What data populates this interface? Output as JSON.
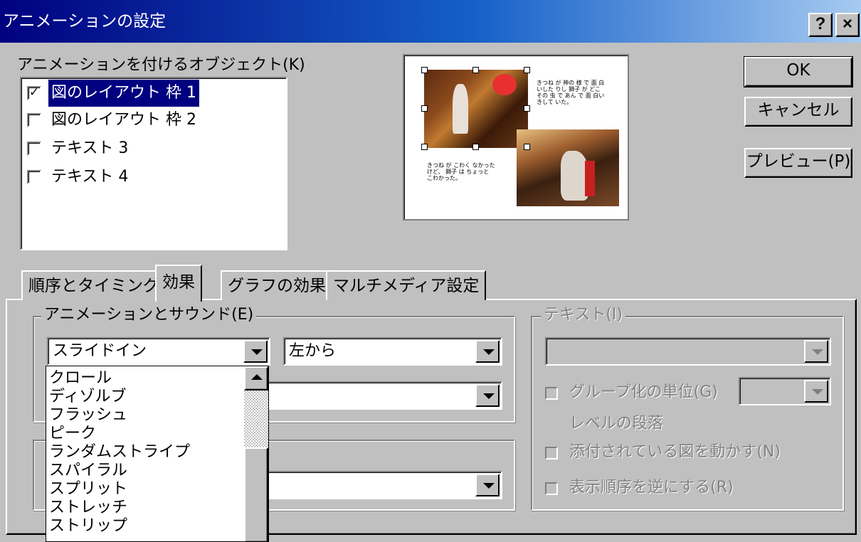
{
  "window": {
    "title": "アニメーションの設定",
    "help_button": "?",
    "close_button": "×"
  },
  "objects": {
    "label": "アニメーションを付けるオブジェクト(K)",
    "items": [
      {
        "label": "図のレイアウト 枠 1",
        "checked": true,
        "selected": true
      },
      {
        "label": "図のレイアウト 枠 2",
        "checked": false,
        "selected": false
      },
      {
        "label": "テキスト 3",
        "checked": false,
        "selected": false
      },
      {
        "label": "テキスト 4",
        "checked": false,
        "selected": false
      }
    ]
  },
  "preview": {
    "text_top": "きつね が 神の 様 で 面 白\nいした りし 獅子 が どこ\nその 虫 で あん で 面 白い\nきして いた。",
    "text_bottom": "きつね が こわく なかった\nけど、 獅子 は ちょっと\nこわかった。"
  },
  "buttons": {
    "ok": "OK",
    "cancel": "キャンセル",
    "preview": "プレビュー(P)"
  },
  "tabs": [
    {
      "label": "順序とタイミング",
      "active": false
    },
    {
      "label": "効果",
      "active": true
    },
    {
      "label": "グラフの効果",
      "active": false
    },
    {
      "label": "マルチメディア設定",
      "active": false
    }
  ],
  "animation_group": {
    "label": "アニメーションとサウンド(E)",
    "effect_value": "スライドイン",
    "direction_value": "左から",
    "sound_value": "",
    "after_value": ""
  },
  "effect_list": [
    "クロール",
    "ディゾルブ",
    "フラッシュ",
    "ピーク",
    "ランダムストライプ",
    "スパイラル",
    "スプリット",
    "ストレッチ",
    "ストリップ"
  ],
  "text_group": {
    "label": "テキスト(I)",
    "group_by_label": "グループ化の単位(G)",
    "level_label": "レベルの段落",
    "animate_attached_label": "添付されている図を動かす(N)",
    "reverse_order_label": "表示順序を逆にする(R)"
  }
}
